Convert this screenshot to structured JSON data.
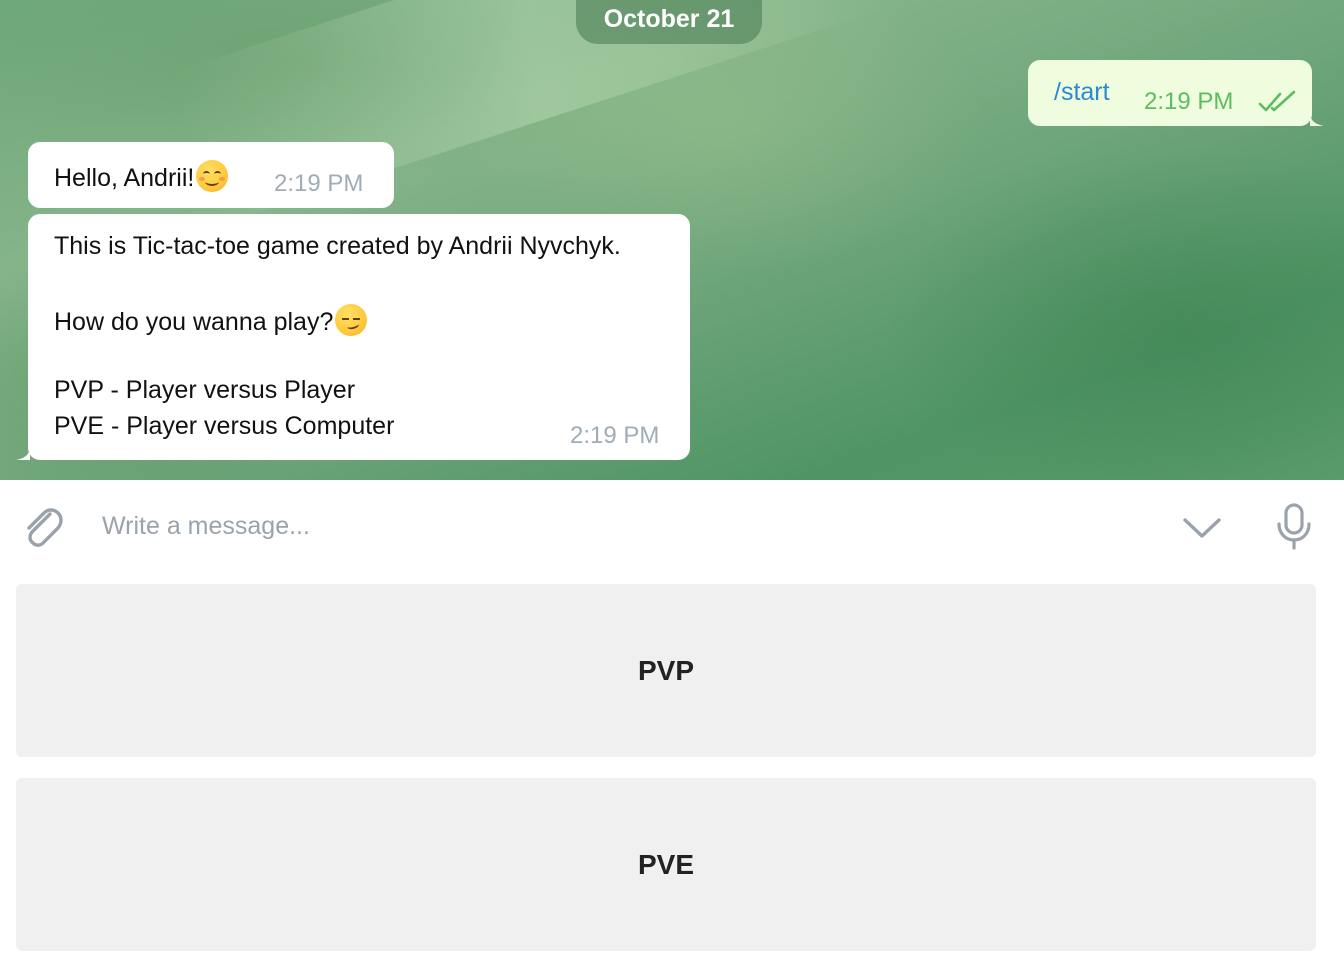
{
  "chat": {
    "date_label": "October 21",
    "messages": [
      {
        "direction": "outgoing",
        "text": "/start",
        "time": "2:19 PM",
        "status_icon": "double-check-icon"
      },
      {
        "direction": "incoming",
        "text": "Hello, Andrii!",
        "emoji": "smiling-face-emoji",
        "time": "2:19 PM"
      },
      {
        "direction": "incoming",
        "lines": [
          "This is Tic-tac-toe game created by Andrii Nyvchyk.",
          "How do you wanna play?",
          "PVP - Player versus Player",
          "PVE - Player versus Computer"
        ],
        "emoji": "smirking-face-emoji",
        "time": "2:19 PM"
      }
    ]
  },
  "composer": {
    "placeholder": "Write a message...",
    "value": "",
    "left_icon": "paperclip-icon",
    "right_icons": [
      "chevron-down-icon",
      "microphone-icon"
    ]
  },
  "keyboard": {
    "buttons": [
      {
        "label": "PVP"
      },
      {
        "label": "PVE"
      }
    ]
  },
  "colors": {
    "outgoing_bubble": "#effdde",
    "incoming_bubble": "#ffffff",
    "outgoing_time": "#5fbb61",
    "incoming_time": "#a0acb6",
    "command_link": "#2a8ad1",
    "keyboard_button": "#f0f0f0"
  }
}
